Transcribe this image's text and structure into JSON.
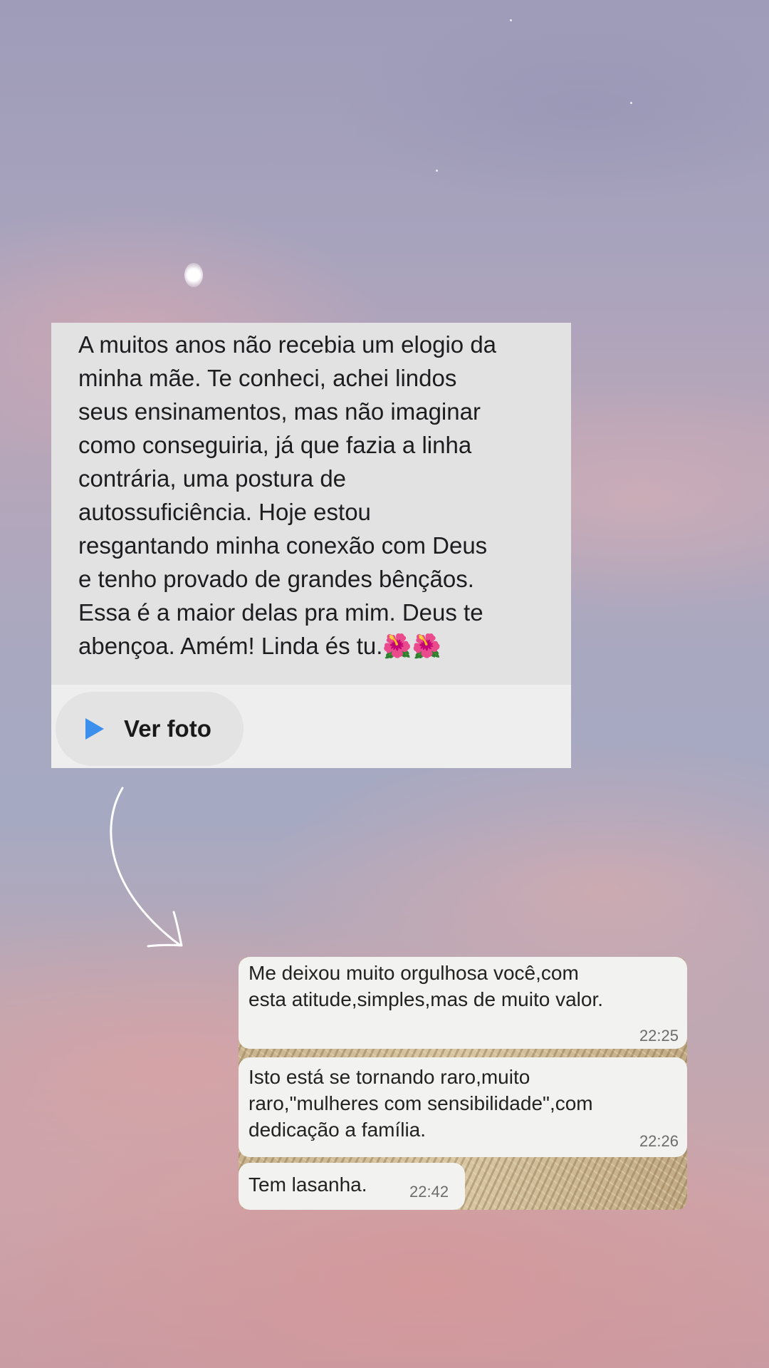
{
  "post_card": {
    "message_lines": [
      "A muitos anos não recebia um elogio da",
      "minha mãe. Te conheci, achei lindos",
      "seus ensinamentos, mas não imaginar",
      "como conseguiria, já que fazia a linha",
      "contrária, uma postura de",
      "autossuficiência. Hoje estou",
      "resgantando minha conexão com Deus",
      "e tenho provado de grandes bênçãos.",
      "Essa é a maior delas pra mim. Deus te",
      "abençoa. Amém! Linda és tu.🌺🌺"
    ],
    "view_photo_label": "Ver foto",
    "accent_color": "#3d8fee"
  },
  "chat": {
    "messages": [
      {
        "lines": [
          "Me deixou muito orgulhosa você,com",
          "esta atitude,simples,mas de muito valor."
        ],
        "time": "22:25"
      },
      {
        "lines": [
          "Isto está se tornando raro,muito",
          "raro,\"mulheres com sensibilidade\",com",
          "dedicação a família."
        ],
        "time": "22:26"
      },
      {
        "lines": [
          "Tem lasanha."
        ],
        "time": "22:42"
      }
    ]
  },
  "icons": {
    "play": "play-icon",
    "arrow": "curved-arrow-icon"
  }
}
